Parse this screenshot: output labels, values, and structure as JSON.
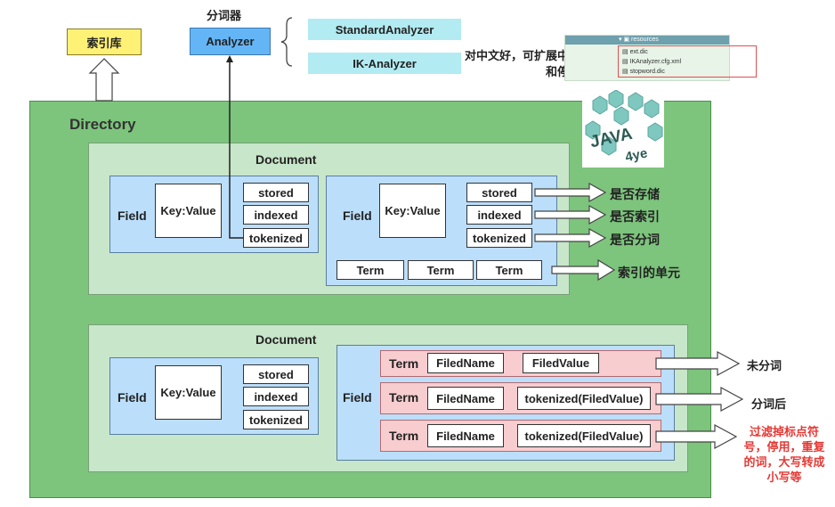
{
  "top": {
    "index_library": "索引库",
    "analyzer_caption": "分词器",
    "analyzer": "Analyzer",
    "standard_analyzer": "StandardAnalyzer",
    "ik_analyzer": "IK-Analyzer",
    "ik_note": "对中文好，可扩展中文词库和停用词库"
  },
  "resources_panel": {
    "folder": "resources",
    "files": [
      "ext.dic",
      "IKAnalyzer.cfg.xml",
      "stopword.dic"
    ]
  },
  "logo": {
    "text_main": "JAVA",
    "text_sub": "4ye"
  },
  "directory": {
    "title": "Directory"
  },
  "doc1": {
    "title": "Document",
    "field_a": {
      "label": "Field",
      "kv": "Key:Value",
      "attrs": [
        "stored",
        "indexed",
        "tokenized"
      ]
    },
    "field_b": {
      "label": "Field",
      "kv": "Key:Value",
      "attrs": [
        "stored",
        "indexed",
        "tokenized"
      ],
      "terms": [
        "Term",
        "Term",
        "Term"
      ]
    },
    "annotations": [
      "是否存储",
      "是否索引",
      "是否分词"
    ],
    "term_note": "索引的单元"
  },
  "doc2": {
    "title": "Document",
    "field_a": {
      "label": "Field",
      "kv": "Key:Value",
      "attrs": [
        "stored",
        "indexed",
        "tokenized"
      ]
    },
    "field_b": {
      "label": "Field",
      "rows": [
        {
          "term": "Term",
          "name": "FiledName",
          "value": "FiledValue",
          "note": "未分词"
        },
        {
          "term": "Term",
          "name": "FiledName",
          "value": "tokenized(FiledValue)",
          "note": "分词后"
        },
        {
          "term": "Term",
          "name": "FiledName",
          "value": "tokenized(FiledValue)",
          "note": "过滤掉标点符号，停用，重复的词，大写转成小写等"
        }
      ]
    }
  },
  "colors": {
    "directory_bg": "#7dc47d",
    "document_bg": "#c8e6c9",
    "field_bg": "#bbdefb",
    "term_row_bg": "#f8cdd0",
    "analyzer_bg": "#64b5f6",
    "index_bg": "#fff176",
    "analyzer_option_bg": "#b2ebf2",
    "red_note": "#e53935"
  }
}
